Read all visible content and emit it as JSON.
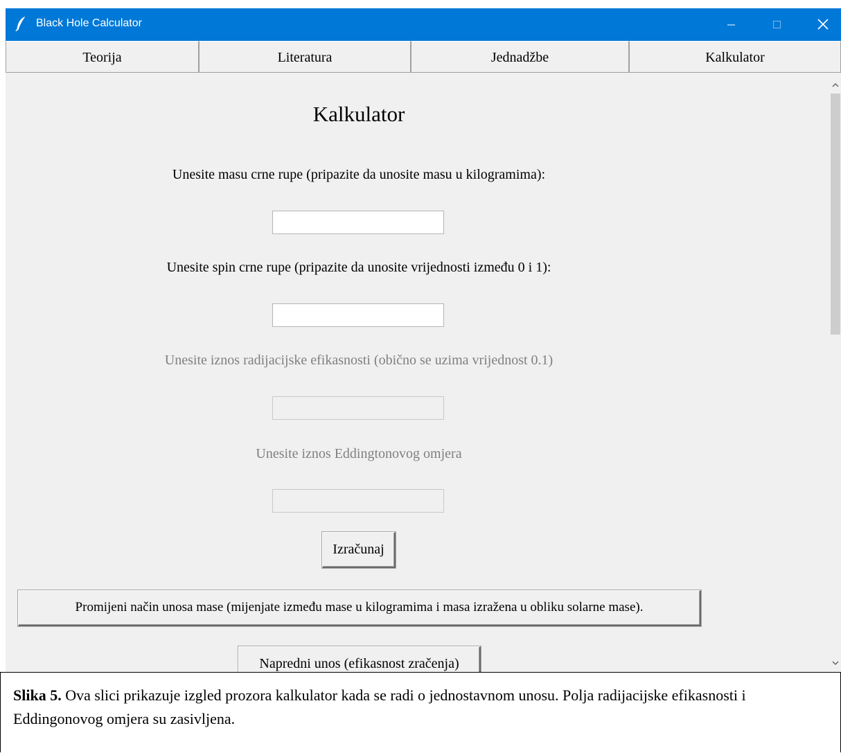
{
  "window": {
    "title": "Black Hole Calculator",
    "accent": "#0078d7"
  },
  "tabs": [
    {
      "label": "Teorija"
    },
    {
      "label": "Literatura"
    },
    {
      "label": "Jednadžbe"
    },
    {
      "label": "Kalkulator"
    }
  ],
  "calculator": {
    "heading": "Kalkulator",
    "mass": {
      "label": "Unesite masu crne rupe (pripazite da unosite masu u kilogramima):",
      "value": ""
    },
    "spin": {
      "label": "Unesite spin crne rupe (pripazite da unosite vrijednosti između 0 i 1):",
      "value": ""
    },
    "efficiency": {
      "label": "Unesite iznos radijacijske efikasnosti (obično se uzima vrijednost 0.1)",
      "value": "",
      "disabled": true
    },
    "eddington": {
      "label": "Unesite iznos Eddingtonovog omjera",
      "value": "",
      "disabled": true
    },
    "calculate_button": "Izračunaj",
    "change_mass_mode_button": "Promijeni način unosa mase (mijenjate između mase u kilogramima i masa izražena u obliku solarne mase).",
    "advanced_input_button": "Napredni unos (efikasnost zračenja)"
  },
  "caption": {
    "bold": "Slika 5.",
    "text": " Ova slici prikazuje izgled prozora kalkulator kada se radi o jednostavnom unosu. Polja radijacijske efikasnosti i Eddingonovog omjera su zasivljena."
  },
  "icons": {
    "app": "feather-icon",
    "minimize": "minimize-icon",
    "maximize": "maximize-icon",
    "close": "close-icon",
    "scroll_up": "chevron-up-icon",
    "scroll_down": "chevron-down-icon"
  }
}
